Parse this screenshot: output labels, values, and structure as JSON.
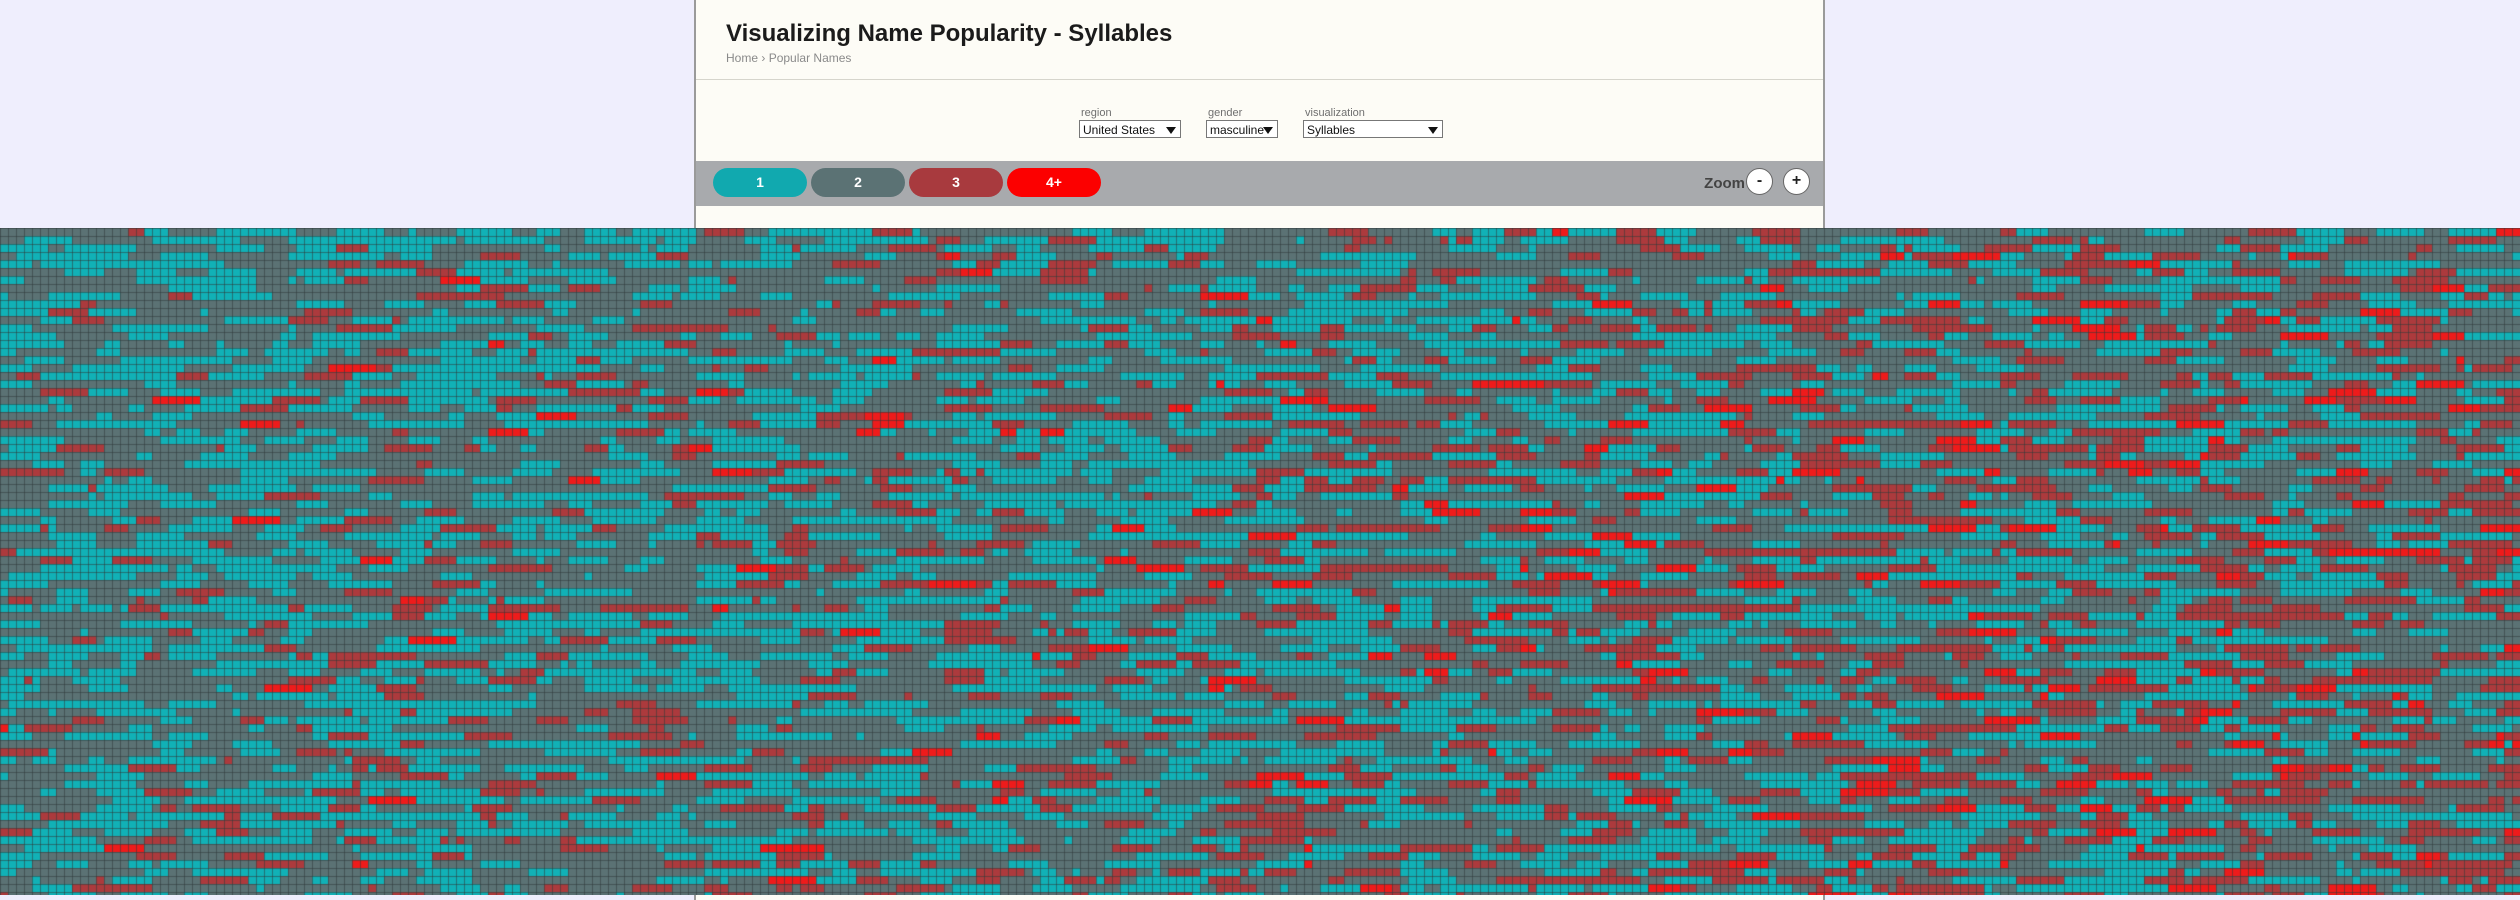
{
  "header": {
    "title": "Visualizing Name Popularity - Syllables",
    "breadcrumb": [
      "Home",
      "Popular Names"
    ],
    "breadcrumb_separator": "›"
  },
  "controls": {
    "region": {
      "label": "region",
      "value": "United States"
    },
    "gender": {
      "label": "gender",
      "value": "masculine"
    },
    "visualization": {
      "label": "visualization",
      "value": "Syllables"
    }
  },
  "legend": {
    "items": [
      {
        "label": "1",
        "color": "#11a9af"
      },
      {
        "label": "2",
        "color": "#5b7274"
      },
      {
        "label": "3",
        "color": "#a83a3e"
      },
      {
        "label": "4+",
        "color": "#fc0000"
      }
    ]
  },
  "zoom": {
    "label": "Zoom",
    "minus": "-",
    "plus": "+"
  },
  "colors": {
    "background": "#efeefd",
    "panel": "#fdfcf6",
    "legend_bar": "#a8aaad",
    "cell_1": "#11b1b6",
    "cell_2": "#5b7274",
    "cell_3": "#ac3a3d",
    "cell_4plus": "#ee1b1b",
    "grid_line": "#2f3a3b"
  }
}
